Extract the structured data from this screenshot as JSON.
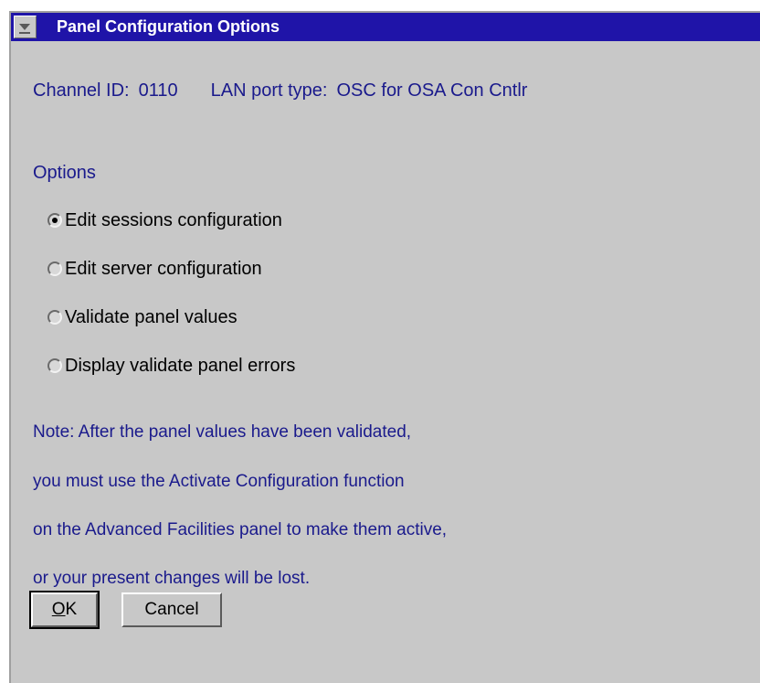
{
  "window": {
    "title": "Panel Configuration Options",
    "system_menu_icon": "system-menu-icon"
  },
  "info": {
    "channel_label": "Channel ID:",
    "channel_value": "0110",
    "lan_label": "LAN port type:",
    "lan_value": "OSC for OSA Con Cntlr"
  },
  "options": {
    "heading": "Options",
    "selected": "Edit sessions configuration",
    "items": [
      {
        "label": "Edit sessions configuration",
        "checked": true
      },
      {
        "label": "Edit server configuration",
        "checked": false
      },
      {
        "label": "Validate panel values",
        "checked": false
      },
      {
        "label": "Display validate panel errors",
        "checked": false
      }
    ]
  },
  "note": {
    "lines": [
      "Note: After the panel values have been validated,",
      "you must use the Activate Configuration function",
      "on the Advanced Facilities panel to make them active,",
      "or your present changes will be lost."
    ]
  },
  "buttons": {
    "ok_mnemonic": "O",
    "ok_rest": "K",
    "cancel": "Cancel"
  },
  "colors": {
    "titlebar": "#1f14a8",
    "text_label": "#1a1a8c",
    "background": "#c8c8c8"
  }
}
